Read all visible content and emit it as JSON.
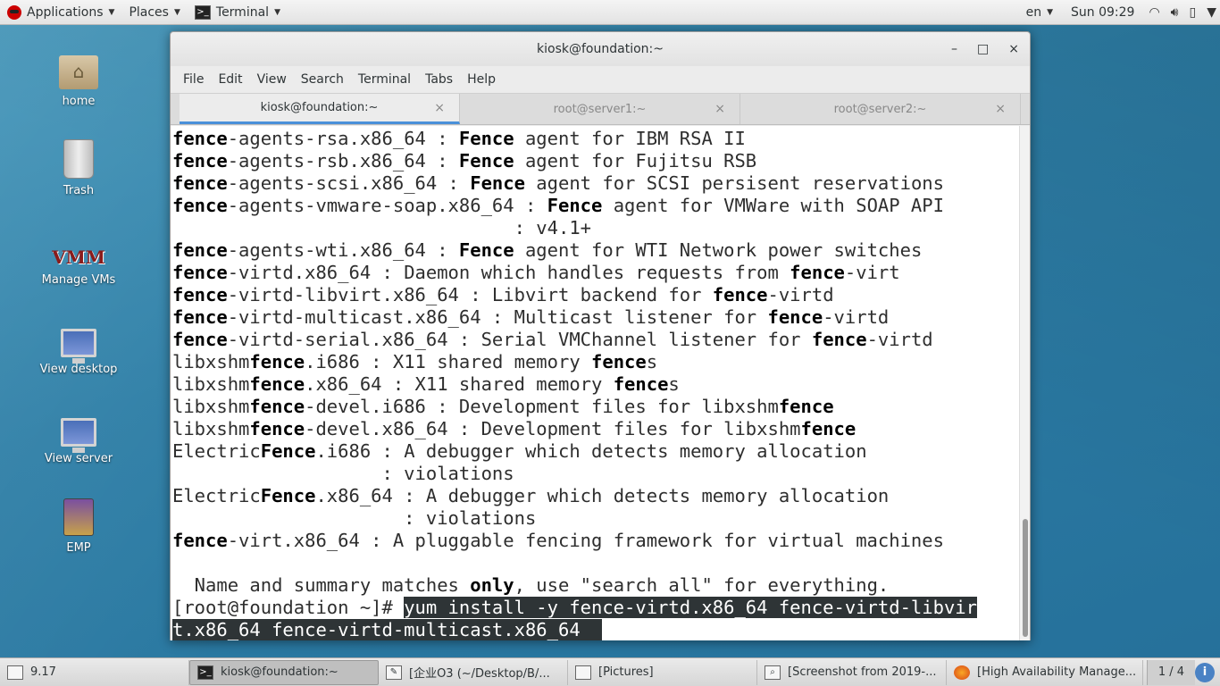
{
  "top_panel": {
    "applications": "Applications",
    "places": "Places",
    "terminal": "Terminal",
    "language": "en",
    "clock": "Sun 09:29"
  },
  "desktop_icons": [
    {
      "label": "home",
      "icon": "home-folder-icon"
    },
    {
      "label": "Trash",
      "icon": "trash-icon"
    },
    {
      "label": "Manage VMs",
      "icon": "vm-icon"
    },
    {
      "label": "View desktop",
      "icon": "monitor-icon"
    },
    {
      "label": "View server",
      "icon": "monitor-icon"
    },
    {
      "label": "EMP",
      "icon": "emp-icon"
    }
  ],
  "window": {
    "title": "kiosk@foundation:~",
    "minimize": "–",
    "maximize": "□",
    "close": "×"
  },
  "menu": [
    "File",
    "Edit",
    "View",
    "Search",
    "Terminal",
    "Tabs",
    "Help"
  ],
  "tabs": [
    {
      "label": "kiosk@foundation:~",
      "close": "×"
    },
    {
      "label": "root@server1:~",
      "close": "×"
    },
    {
      "label": "root@server2:~",
      "close": "×"
    }
  ],
  "terminal_lines": [
    [
      [
        "b",
        "fence"
      ],
      [
        "",
        "-agents-rsa.x86_64 : "
      ],
      [
        "b",
        "Fence"
      ],
      [
        "",
        " agent for IBM RSA II"
      ]
    ],
    [
      [
        "b",
        "fence"
      ],
      [
        "",
        "-agents-rsb.x86_64 : "
      ],
      [
        "b",
        "Fence"
      ],
      [
        "",
        " agent for Fujitsu RSB"
      ]
    ],
    [
      [
        "b",
        "fence"
      ],
      [
        "",
        "-agents-scsi.x86_64 : "
      ],
      [
        "b",
        "Fence"
      ],
      [
        "",
        " agent for SCSI persisent reservations"
      ]
    ],
    [
      [
        "b",
        "fence"
      ],
      [
        "",
        "-agents-vmware-soap.x86_64 : "
      ],
      [
        "b",
        "Fence"
      ],
      [
        "",
        " agent for VMWare with SOAP API"
      ]
    ],
    [
      [
        "",
        "                               : v4.1+"
      ]
    ],
    [
      [
        "b",
        "fence"
      ],
      [
        "",
        "-agents-wti.x86_64 : "
      ],
      [
        "b",
        "Fence"
      ],
      [
        "",
        " agent for WTI Network power switches"
      ]
    ],
    [
      [
        "b",
        "fence"
      ],
      [
        "",
        "-virtd.x86_64 : Daemon which handles requests from "
      ],
      [
        "b",
        "fence"
      ],
      [
        "",
        "-virt"
      ]
    ],
    [
      [
        "b",
        "fence"
      ],
      [
        "",
        "-virtd-libvirt.x86_64 : Libvirt backend for "
      ],
      [
        "b",
        "fence"
      ],
      [
        "",
        "-virtd"
      ]
    ],
    [
      [
        "b",
        "fence"
      ],
      [
        "",
        "-virtd-multicast.x86_64 : Multicast listener for "
      ],
      [
        "b",
        "fence"
      ],
      [
        "",
        "-virtd"
      ]
    ],
    [
      [
        "b",
        "fence"
      ],
      [
        "",
        "-virtd-serial.x86_64 : Serial VMChannel listener for "
      ],
      [
        "b",
        "fence"
      ],
      [
        "",
        "-virtd"
      ]
    ],
    [
      [
        "",
        "libxshm"
      ],
      [
        "b",
        "fence"
      ],
      [
        "",
        ".i686 : X11 shared memory "
      ],
      [
        "b",
        "fence"
      ],
      [
        "",
        "s"
      ]
    ],
    [
      [
        "",
        "libxshm"
      ],
      [
        "b",
        "fence"
      ],
      [
        "",
        ".x86_64 : X11 shared memory "
      ],
      [
        "b",
        "fence"
      ],
      [
        "",
        "s"
      ]
    ],
    [
      [
        "",
        "libxshm"
      ],
      [
        "b",
        "fence"
      ],
      [
        "",
        "-devel.i686 : Development files for libxshm"
      ],
      [
        "b",
        "fence"
      ]
    ],
    [
      [
        "",
        "libxshm"
      ],
      [
        "b",
        "fence"
      ],
      [
        "",
        "-devel.x86_64 : Development files for libxshm"
      ],
      [
        "b",
        "fence"
      ]
    ],
    [
      [
        "",
        "Electric"
      ],
      [
        "b",
        "Fence"
      ],
      [
        "",
        ".i686 : A debugger which detects memory allocation"
      ]
    ],
    [
      [
        "",
        "                   : violations"
      ]
    ],
    [
      [
        "",
        "Electric"
      ],
      [
        "b",
        "Fence"
      ],
      [
        "",
        ".x86_64 : A debugger which detects memory allocation"
      ]
    ],
    [
      [
        "",
        "                     : violations"
      ]
    ],
    [
      [
        "b",
        "fence"
      ],
      [
        "",
        "-virt.x86_64 : A pluggable fencing framework for virtual machines"
      ]
    ],
    [
      [
        "",
        ""
      ]
    ],
    [
      [
        "",
        "  Name and summary matches "
      ],
      [
        "b",
        "only"
      ],
      [
        "",
        ", use \"search all\" for everything."
      ]
    ],
    [
      [
        "",
        "[root@foundation ~]# "
      ],
      [
        "sel",
        "yum install -y fence-virtd.x86_64 fence-virtd-libvir"
      ]
    ],
    [
      [
        "sel",
        "t.x86_64 fence-virtd-multicast.x86_64  "
      ]
    ]
  ],
  "taskbar": {
    "workspace_label": "9.17",
    "tasks": [
      {
        "label": "kiosk@foundation:~",
        "icon": "terminal-icon"
      },
      {
        "label": "[企业O3 (~/Desktop/B/...",
        "icon": "text-editor-icon"
      },
      {
        "label": "[Pictures]",
        "icon": "file-manager-icon"
      },
      {
        "label": "[Screenshot from 2019-...",
        "icon": "image-viewer-icon"
      },
      {
        "label": "[High Availability Manage...",
        "icon": "firefox-icon"
      }
    ],
    "pager": "1 / 4"
  }
}
